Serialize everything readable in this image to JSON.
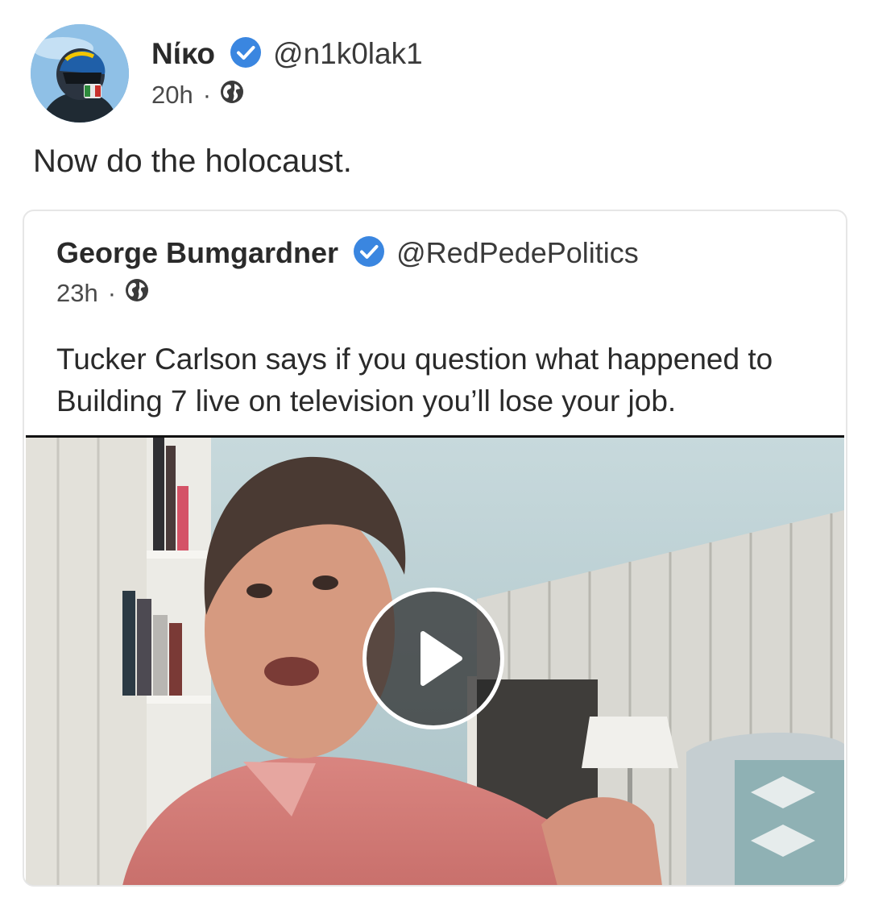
{
  "post": {
    "author": {
      "display_name": "Νίκο",
      "handle": "@n1k0lak1",
      "verified": true
    },
    "time": "20h",
    "separator": "·",
    "visibility_icon": "globe-icon",
    "text": "Now do the holocaust."
  },
  "quoted": {
    "author": {
      "display_name": "George Bumgardner",
      "handle": "@RedPedePolitics",
      "verified": true
    },
    "time": "23h",
    "separator": "·",
    "visibility_icon": "globe-icon",
    "text": "Tucker Carlson says if you question what happened to Building 7 live on television you’ll lose your job.",
    "media": {
      "type": "video",
      "play_icon": "play-icon"
    }
  },
  "colors": {
    "verified_badge": "#3a86e0",
    "card_border": "#e6e6e6",
    "text_primary": "#2a2a2a",
    "text_secondary": "#4a4a4a"
  }
}
